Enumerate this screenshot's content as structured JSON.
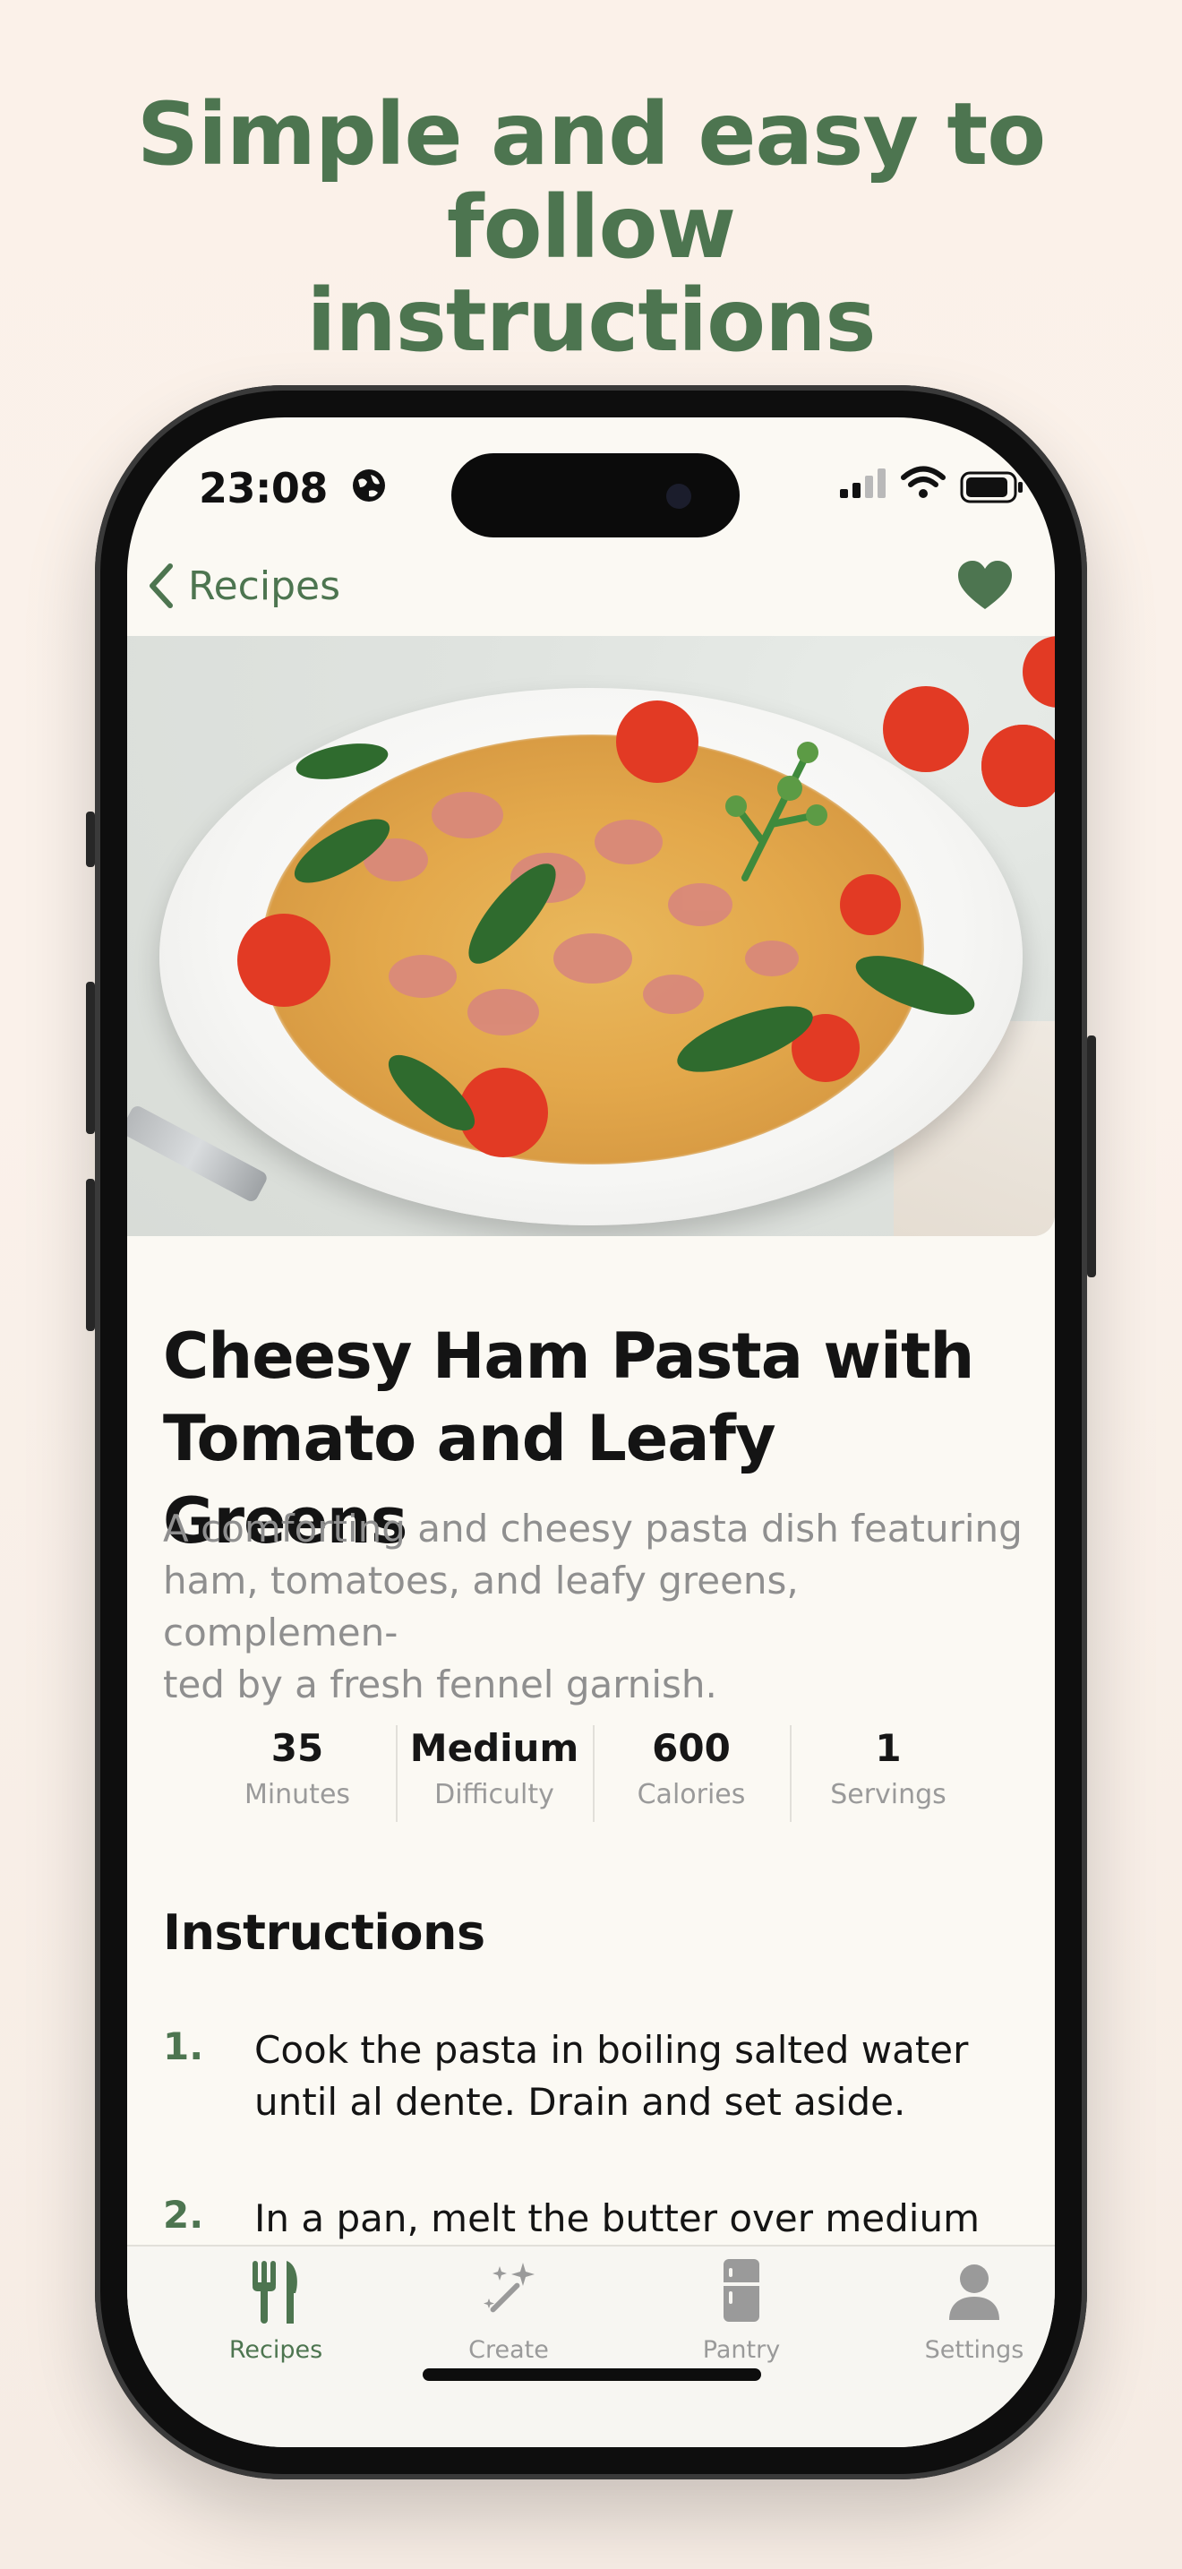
{
  "headline": {
    "line1": "Simple and easy to follow",
    "line2": "instructions"
  },
  "status_bar": {
    "time": "23:08"
  },
  "nav": {
    "back_label": "Recipes",
    "favorite_icon": "heart-icon",
    "favorited": true
  },
  "recipe": {
    "title_line1": "Cheesy Ham Pasta with",
    "title_line2": "Tomato and Leafy Greens",
    "desc_line1": "A comforting and cheesy pasta dish featuring",
    "desc_line2": "ham, tomatoes, and leafy greens, complemen-",
    "desc_line3": "ted by a fresh fennel garnish.",
    "stats": [
      {
        "value": "35",
        "label": "Minutes"
      },
      {
        "value": "Medium",
        "label": "Difficulty"
      },
      {
        "value": "600",
        "label": "Calories"
      },
      {
        "value": "1",
        "label": "Servings"
      }
    ]
  },
  "instructions": {
    "heading": "Instructions",
    "steps": [
      {
        "num": "1.",
        "line1": "Cook the pasta in boiling salted water",
        "line2": "until al dente. Drain and set aside."
      },
      {
        "num": "2.",
        "line1": "In a pan, melt the butter over medium"
      }
    ]
  },
  "tabs": [
    {
      "label": "Recipes",
      "icon": "fork-knife-icon",
      "active": true
    },
    {
      "label": "Create",
      "icon": "sparkle-wand-icon",
      "active": false
    },
    {
      "label": "Pantry",
      "icon": "fridge-icon",
      "active": false
    },
    {
      "label": "Settings",
      "icon": "person-icon",
      "active": false
    }
  ],
  "colors": {
    "accent": "#4d7550",
    "inactive": "#9a9a9a",
    "background": "#fbf9f3"
  }
}
